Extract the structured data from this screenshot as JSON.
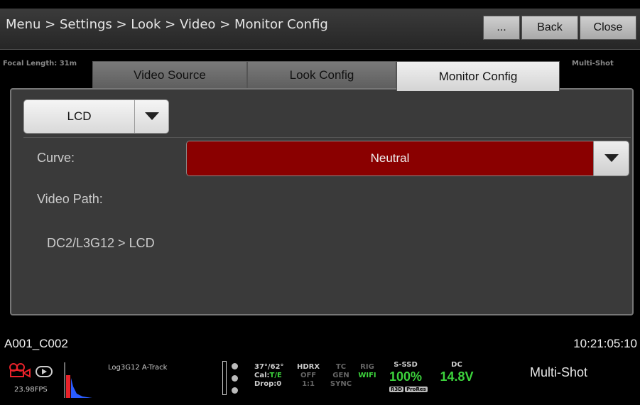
{
  "header": {
    "breadcrumb": "Menu > Settings > Look > Video > Monitor Config",
    "more_label": "...",
    "back_label": "Back",
    "close_label": "Close"
  },
  "background": {
    "focal_length": "Focal Length: 31m",
    "multishot_tag": "Multi-Shot"
  },
  "tabs": [
    {
      "label": "Video Source",
      "active": false
    },
    {
      "label": "Look Config",
      "active": false
    },
    {
      "label": "Monitor Config",
      "active": true
    }
  ],
  "monitor_select": {
    "value": "LCD"
  },
  "curve": {
    "label": "Curve:",
    "value": "Neutral",
    "color": "#8a0000"
  },
  "video_path": {
    "label": "Video Path:",
    "value": "DC2/L3G12 > LCD"
  },
  "clip": {
    "name": "A001_C002",
    "timecode": "10:21:05:10"
  },
  "status": {
    "fps": "23.98FPS",
    "look": "Log3G12  A-Track",
    "temp": "37°/62°",
    "cal_label": "Cal:",
    "cal_value": "T/E",
    "drop": "Drop:0",
    "hdrx": "HDRX",
    "hdrx_state": "OFF",
    "hdrx_ratio": "1:1",
    "tc": "TC",
    "tc_state": "GEN",
    "sync": "SYNC",
    "rig": "RIG",
    "wifi": "WIFI",
    "media_label": "S-SSD",
    "media_value": "100%",
    "badge_r3d": "R3D",
    "badge_prores": "ProRes",
    "power_label": "DC",
    "power_value": "14.8V",
    "mode": "Multi-Shot"
  },
  "colors": {
    "accent_red": "#8a0000",
    "status_green": "#3cd23c",
    "record_red": "#e8222a"
  }
}
